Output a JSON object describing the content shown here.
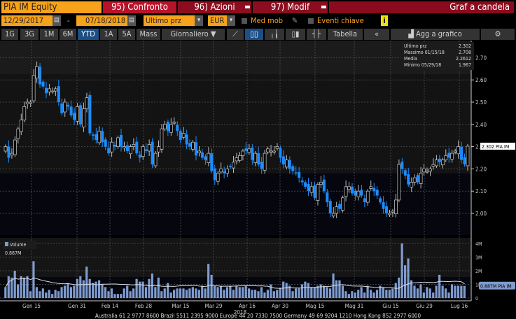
{
  "header": {
    "ticker": "PIA IM Equity",
    "compare": "95) Confronto",
    "actions": "96) Azioni",
    "modify": "97) Modif",
    "title": "Graf a candela"
  },
  "controls": {
    "start_date": "12/29/2017",
    "separator": "-",
    "end_date": "07/18/2018",
    "price_field": "Ultimo prz",
    "currency": "EUR",
    "moving_avg": "Med mob",
    "key_events": "Eventi chiave",
    "info": "i"
  },
  "periods": [
    "1G",
    "3G",
    "1M",
    "6M",
    "YTD",
    "1A",
    "5A",
    "Mass"
  ],
  "selected_period": "YTD",
  "frequency": "Giornaliero ▼",
  "toolbar": {
    "table": "Tabella",
    "collapse": "«",
    "add_to_chart": "Agg a grafico",
    "settings": "⚙"
  },
  "legend": {
    "rows": [
      {
        "label": "Ultimo prz",
        "value": "2.302"
      },
      {
        "label": "Massimo 01/15/18",
        "value": "2.708"
      },
      {
        "label": "Media",
        "value": "2.2612"
      },
      {
        "label": "Minimo 05/29/18",
        "value": "1.967"
      }
    ]
  },
  "volume_legend": "Volume 0.887M",
  "colors": {
    "down": "#1a8cff",
    "up": "#000000",
    "accent": "#f7a21b"
  },
  "chart_data": [
    {
      "type": "candlestick",
      "ylim": [
        1.95,
        2.75
      ],
      "yticks": [
        "2.70",
        "2.60",
        "2.50",
        "2.40",
        "2.30",
        "2.20",
        "2.10",
        "2.00"
      ],
      "last_label": "2.302 PIA IM",
      "close": [
        2.3,
        2.25,
        2.27,
        2.33,
        2.38,
        2.42,
        2.48,
        2.5,
        2.5,
        2.62,
        2.66,
        2.58,
        2.57,
        2.54,
        2.56,
        2.55,
        2.56,
        2.5,
        2.45,
        2.5,
        2.48,
        2.44,
        2.42,
        2.48,
        2.4,
        2.47,
        2.52,
        2.36,
        2.35,
        2.33,
        2.37,
        2.32,
        2.3,
        2.27,
        2.32,
        2.3,
        2.34,
        2.3,
        2.3,
        2.28,
        2.3,
        2.31,
        2.27,
        2.25,
        2.3,
        2.28,
        2.31,
        2.22,
        2.27,
        2.3,
        2.38,
        2.4,
        2.37,
        2.4,
        2.41,
        2.37,
        2.33,
        2.36,
        2.31,
        2.3,
        2.32,
        2.26,
        2.28,
        2.25,
        2.24,
        2.27,
        2.19,
        2.15,
        2.18,
        2.2,
        2.18,
        2.2,
        2.21,
        2.23,
        2.25,
        2.26,
        2.28,
        2.28,
        2.29,
        2.24,
        2.27,
        2.22,
        2.2,
        2.27,
        2.29,
        2.28,
        2.28,
        2.3,
        2.25,
        2.22,
        2.24,
        2.2,
        2.19,
        2.18,
        2.16,
        2.14,
        2.12,
        2.1,
        2.12,
        2.07,
        2.13,
        2.14,
        2.1,
        2.05,
        2.0,
        2.0,
        2.03,
        2.02,
        2.07,
        2.12,
        2.12,
        2.09,
        2.08,
        2.1,
        2.08,
        2.05,
        2.1,
        2.12,
        2.1,
        2.08,
        2.05,
        2.02,
        2.0,
        2.0,
        2.01,
        2.06,
        2.22,
        2.2,
        2.17,
        2.13,
        2.14,
        2.16,
        2.14,
        2.18,
        2.2,
        2.19,
        2.2,
        2.22,
        2.24,
        2.23,
        2.24,
        2.26,
        2.25,
        2.27,
        2.28,
        2.3,
        2.24,
        2.22,
        2.302
      ]
    },
    {
      "type": "bar",
      "ylim": [
        0,
        4.2
      ],
      "yticks": [
        "4M",
        "3M",
        "2M",
        "1M",
        "0"
      ],
      "last_label": "0.887M PIA IM",
      "xticks": [
        "Gen 15",
        "Gen 31",
        "Feb 14",
        "Feb 28",
        "Mar 15",
        "Mar 29",
        "Apr 16",
        "Apr 30",
        "Mag 15",
        "Mag 31",
        "Giu 15",
        "Giu 29",
        "Lug 16"
      ],
      "year": "2018",
      "volume_m": [
        0.8,
        1.6,
        1.5,
        2.0,
        1.0,
        1.6,
        1.5,
        1.6,
        0.5,
        2.7,
        0.8,
        0.5,
        0.7,
        0.4,
        0.6,
        0.3,
        0.6,
        0.5,
        0.8,
        0.9,
        1.1,
        0.8,
        0.9,
        1.4,
        1.6,
        1.3,
        2.3,
        1.4,
        1.1,
        1.2,
        1.3,
        1.0,
        0.8,
        0.5,
        0.7,
        0.3,
        0.3,
        0.3,
        0.7,
        0.9,
        0.5,
        0.7,
        1.4,
        1.2,
        1.2,
        0.8,
        1.4,
        1.8,
        0.8,
        1.5,
        0.5,
        0.7,
        1.1,
        0.4,
        0.6,
        0.7,
        0.7,
        0.7,
        0.6,
        0.7,
        0.8,
        0.7,
        0.6,
        0.9,
        0.7,
        2.5,
        1.7,
        0.9,
        0.8,
        0.9,
        0.6,
        0.8,
        0.9,
        0.6,
        0.9,
        0.8,
        0.8,
        0.9,
        0.7,
        0.6,
        0.6,
        0.5,
        0.8,
        0.4,
        0.6,
        1.0,
        0.5,
        0.6,
        0.7,
        1.2,
        1.1,
        0.9,
        0.5,
        0.7,
        0.7,
        1.0,
        1.2,
        1.1,
        0.8,
        0.8,
        0.9,
        1.0,
        0.9,
        0.8,
        0.7,
        1.8,
        1.3,
        1.3,
        0.9,
        0.5,
        0.3,
        0.5,
        0.4,
        0.6,
        0.8,
        0.4,
        0.9,
        0.6,
        0.4,
        0.6,
        0.9,
        0.8,
        0.6,
        0.6,
        0.7,
        1.1,
        1.5,
        4.0,
        2.4,
        2.9,
        1.3,
        0.9,
        0.7,
        1.0,
        0.4,
        0.8,
        0.7,
        0.4,
        0.9,
        1.7,
        0.9,
        0.7,
        0.4,
        1.0,
        0.9,
        0.9,
        0.9,
        0.887
      ]
    }
  ],
  "footer": "Australia 61 2 9777 8600 Brazil 5511 2395 9000 Europe 44 20 7330 7500 Germany 49 69 9204 1210 Hong Kong 852 2977 6000"
}
